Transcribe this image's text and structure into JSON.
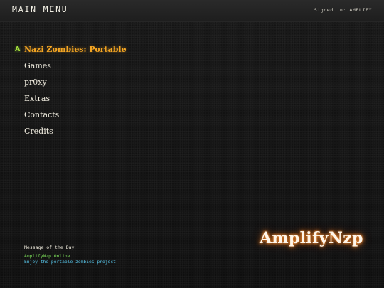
{
  "header": {
    "title": "MAIN MENU",
    "signed_in": "Signed in: AMPLIFY"
  },
  "menu": {
    "selected_index": 0,
    "selector_glyph": "A",
    "items": [
      {
        "label": "Nazi Zombies: Portable"
      },
      {
        "label": "Games"
      },
      {
        "label": "pr0xy"
      },
      {
        "label": "Extras"
      },
      {
        "label": "Contacts"
      },
      {
        "label": "Credits"
      }
    ]
  },
  "motd": {
    "heading": "Message of the Day",
    "line1": "AmplifyNzp Online",
    "line2": "Enjoy the portable zombies project"
  },
  "logo": {
    "text": "AmplifyNzp"
  },
  "colors": {
    "selected": "#f5a623",
    "indicator": "#a4e23c",
    "motd_line1": "#7de05a",
    "motd_line2": "#58c6ea",
    "logo_glow": "#e8741c"
  }
}
